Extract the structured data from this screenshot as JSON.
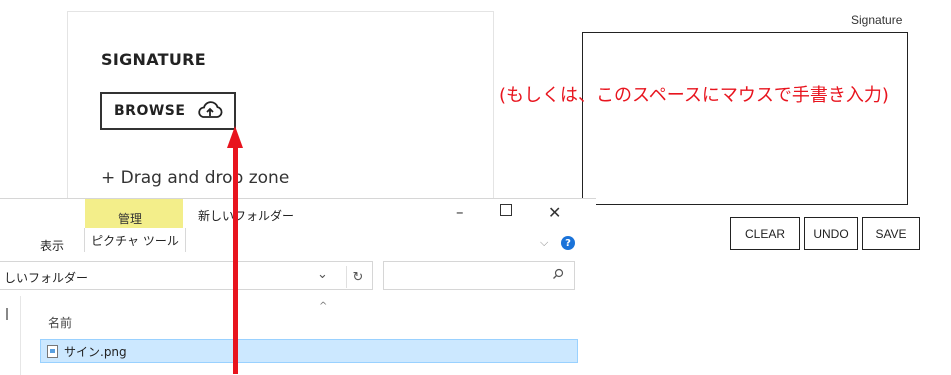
{
  "upload": {
    "title": "SIGNATURE",
    "browse_label": "BROWSE",
    "browse_icon": "cloud-upload-icon",
    "drag_text": "+ Drag and drop zone"
  },
  "pad": {
    "label": "Signature",
    "clear_label": "CLEAR",
    "undo_label": "UNDO",
    "save_label": "SAVE"
  },
  "annotation": {
    "text": "(もしくは、このスペースにマウスで手書き入力)",
    "color": "#e8141e"
  },
  "explorer": {
    "context_label": "管理",
    "context_color": "#f3ee8a",
    "title": "新しいフォルダー",
    "minimize": "–",
    "maximize": "□",
    "close": "✕",
    "tab_view": "表示",
    "tab_picture_tools": "ピクチャ ツール",
    "address": "しいフォルダー",
    "column_name": "名前",
    "files": [
      {
        "name": "サイン.png",
        "selected": true
      }
    ]
  }
}
